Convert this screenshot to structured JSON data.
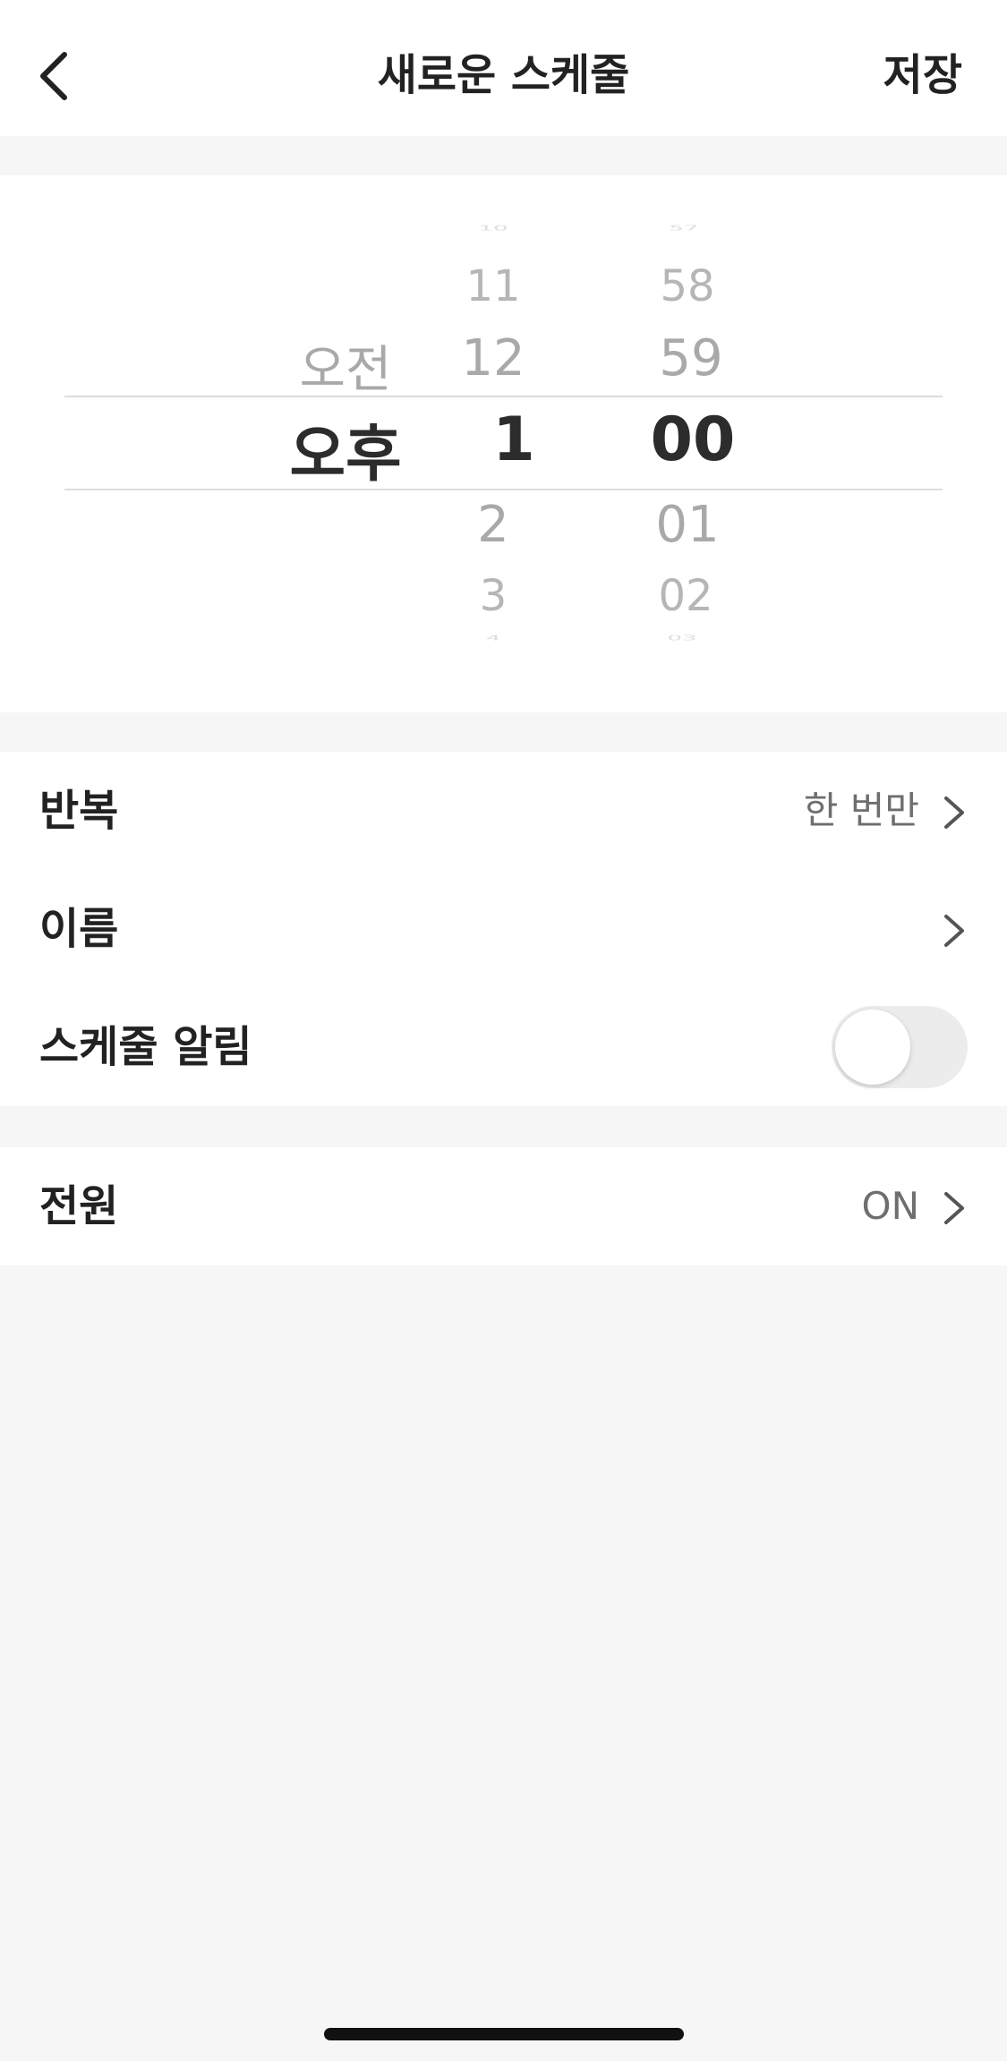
{
  "header": {
    "back_icon": "chevron-left-icon",
    "title": "새로운 스케줄",
    "save_label": "저장"
  },
  "picker": {
    "ampm": {
      "above": "오전",
      "selected": "오후"
    },
    "hour": {
      "above": [
        "10",
        "11",
        "12"
      ],
      "selected": "1",
      "below": [
        "2",
        "3",
        "4"
      ]
    },
    "minute": {
      "above": [
        "57",
        "58",
        "59"
      ],
      "selected": "00",
      "below": [
        "01",
        "02",
        "03"
      ]
    }
  },
  "settings": {
    "repeat": {
      "label": "반복",
      "value": "한 번만",
      "icon": "chevron-right-icon"
    },
    "name": {
      "label": "이름",
      "icon": "chevron-right-icon"
    },
    "notification": {
      "label": "스케줄 알림",
      "enabled": false
    }
  },
  "power": {
    "label": "전원",
    "value": "ON",
    "icon": "chevron-right-icon"
  },
  "colors": {
    "background": "#f6f6f6",
    "card": "#ffffff",
    "text_primary": "#222222",
    "text_secondary": "#6e6e6e",
    "toggle_off": "#ececec"
  }
}
